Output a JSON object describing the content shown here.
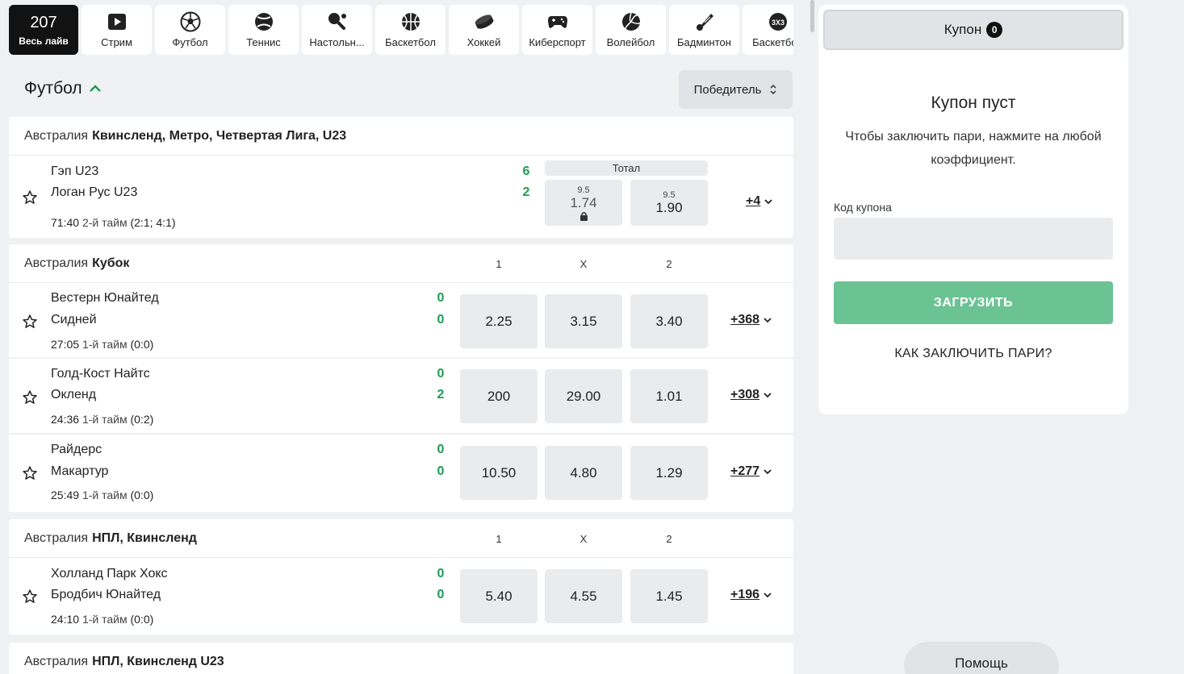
{
  "sports": [
    {
      "count": "207",
      "label": "Весь лайв",
      "icon": "live-icon"
    },
    {
      "label": "Стрим",
      "icon": "stream-icon"
    },
    {
      "label": "Футбол",
      "icon": "football-icon"
    },
    {
      "label": "Теннис",
      "icon": "tennis-icon"
    },
    {
      "label": "Настольн...",
      "icon": "table-tennis-icon"
    },
    {
      "label": "Баскетбол",
      "icon": "basketball-icon"
    },
    {
      "label": "Хоккей",
      "icon": "hockey-icon"
    },
    {
      "label": "Киберспорт",
      "icon": "gamepad-icon"
    },
    {
      "label": "Волейбол",
      "icon": "volleyball-icon"
    },
    {
      "label": "Бадминтон",
      "icon": "badminton-icon"
    },
    {
      "label": "Баскетбол",
      "icon": "basketball-3x3-icon"
    }
  ],
  "section": {
    "title": "Футбол",
    "market": "Победитель"
  },
  "leagues": [
    {
      "country": "Австралия",
      "name": "Квинсленд, Метро, Четвертая Лига, U23",
      "events": [
        {
          "team1": "Гэп U23",
          "team2": "Логан Рус U23",
          "score1": "6",
          "score2": "2",
          "time": "71:40",
          "period": "2-й тайм",
          "detail": "(2:1; 4:1)",
          "market_label": "Тотал",
          "odds": [
            {
              "param": "9.5",
              "value": "1.74",
              "locked": true
            },
            {
              "param": "9.5",
              "value": "1.90"
            }
          ],
          "more": "+4"
        }
      ]
    },
    {
      "country": "Австралия",
      "name": "Кубок",
      "cols": [
        "1",
        "X",
        "2"
      ],
      "events": [
        {
          "team1": "Вестерн Юнайтед",
          "team2": "Сидней",
          "score1": "0",
          "score2": "0",
          "time": "27:05",
          "period": "1-й тайм",
          "detail": "(0:0)",
          "odds": [
            "2.25",
            "3.15",
            "3.40"
          ],
          "more": "+368"
        },
        {
          "team1": "Голд-Кост Найтс",
          "team2": "Окленд",
          "score1": "0",
          "score2": "2",
          "time": "24:36",
          "period": "1-й тайм",
          "detail": "(0:2)",
          "odds": [
            "200",
            "29.00",
            "1.01"
          ],
          "more": "+308"
        },
        {
          "team1": "Райдерс",
          "team2": "Макартур",
          "score1": "0",
          "score2": "0",
          "time": "25:49",
          "period": "1-й тайм",
          "detail": "(0:0)",
          "odds": [
            "10.50",
            "4.80",
            "1.29"
          ],
          "more": "+277"
        }
      ]
    },
    {
      "country": "Австралия",
      "name": "НПЛ, Квинсленд",
      "cols": [
        "1",
        "X",
        "2"
      ],
      "events": [
        {
          "team1": "Холланд Парк Хокс",
          "team2": "Бродбич Юнайтед",
          "score1": "0",
          "score2": "0",
          "time": "24:10",
          "period": "1-й тайм",
          "detail": "(0:0)",
          "odds": [
            "5.40",
            "4.55",
            "1.45"
          ],
          "more": "+196"
        }
      ]
    },
    {
      "country": "Австралия",
      "name": "НПЛ, Квинсленд U23",
      "events": []
    }
  ],
  "coupon": {
    "tab_label": "Купон",
    "count": "0",
    "empty_title": "Купон пуст",
    "empty_text": "Чтобы заключить пари, нажмите на любой коэффициент.",
    "code_label": "Код купона",
    "code_value": "",
    "load_button": "ЗАГРУЗИТЬ",
    "howto_link": "КАК ЗАКЛЮЧИТЬ ПАРИ?"
  },
  "help_button": "Помощь",
  "colors": {
    "accent_green": "#1d9b54",
    "load_button": "#6bc394",
    "active_tab": "#121212"
  }
}
